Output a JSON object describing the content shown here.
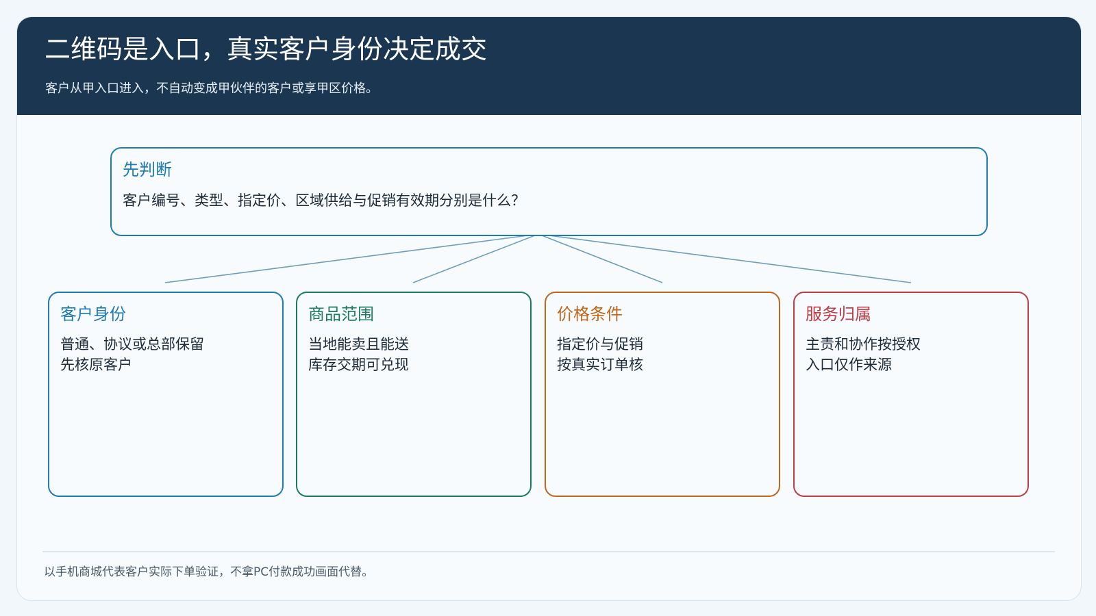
{
  "header": {
    "title": "二维码是入口，真实客户身份决定成交",
    "subtitle": "客户从甲入口进入，不自动变成甲伙伴的客户或享甲区价格。"
  },
  "decision": {
    "heading": "先判断",
    "question": "客户编号、类型、指定价、区域供给与促销有效期分别是什么？",
    "color": "#1f7bb3"
  },
  "cards": [
    {
      "title": "客户身份",
      "lines": [
        "普通、协议或总部保留",
        "先核原客户"
      ],
      "color": "#1f7bb3"
    },
    {
      "title": "商品范围",
      "lines": [
        "当地能卖且能送",
        "库存交期可兑现"
      ],
      "color": "#1b7d5c"
    },
    {
      "title": "价格条件",
      "lines": [
        "指定价与促销",
        "按真实订单核"
      ],
      "color": "#c1671c"
    },
    {
      "title": "服务归属",
      "lines": [
        "主责和协作按授权",
        "入口仅作来源"
      ],
      "color": "#bf3c45"
    }
  ],
  "connector_color": "#6e9db8",
  "footer": {
    "note": "以手机商城代表客户实际下单验证，不拿PC付款成功画面代替。"
  }
}
